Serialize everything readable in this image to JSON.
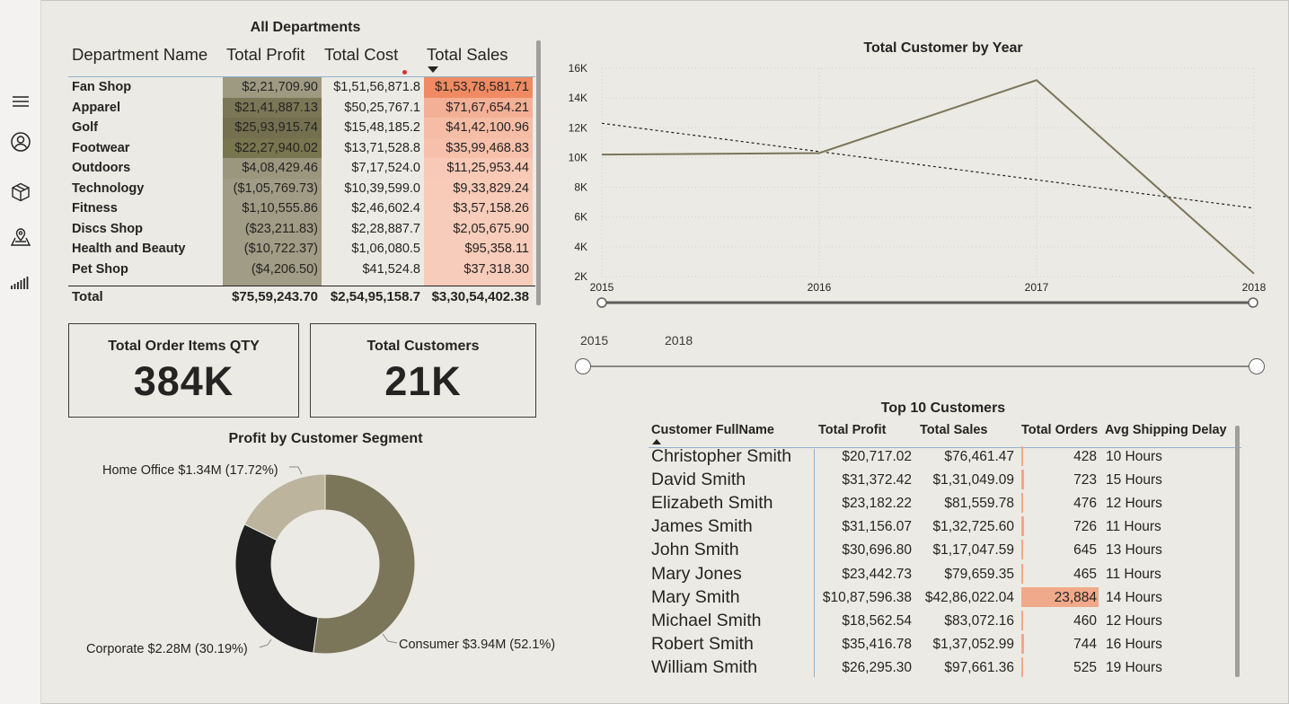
{
  "sidebar": {
    "icons": [
      "menu-icon",
      "user-icon",
      "package-icon",
      "map-icon",
      "bar-signal-icon"
    ]
  },
  "departments": {
    "title": "All Departments",
    "columns": [
      "Department Name",
      "Total Profit",
      "Total Cost",
      "Total Sales"
    ],
    "rows": [
      {
        "name": "Fan Shop",
        "profit": "$2,21,709.90",
        "cost": "$1,51,56,871.8",
        "sales": "$1,53,78,581.71",
        "profit_shade": "#9e9a82",
        "sales_shade": "#ef8a62"
      },
      {
        "name": "Apparel",
        "profit": "$21,41,887.13",
        "cost": "$50,25,767.1",
        "sales": "$71,67,654.21",
        "profit_shade": "#7b7756",
        "sales_shade": "#f4b096"
      },
      {
        "name": "Golf",
        "profit": "$25,93,915.74",
        "cost": "$15,48,185.2",
        "sales": "$41,42,100.96",
        "profit_shade": "#736f4f",
        "sales_shade": "#f6bda6"
      },
      {
        "name": "Footwear",
        "profit": "$22,27,940.02",
        "cost": "$13,71,528.8",
        "sales": "$35,99,468.83",
        "profit_shade": "#79754f",
        "sales_shade": "#f6c0aa"
      },
      {
        "name": "Outdoors",
        "profit": "$4,08,429.46",
        "cost": "$7,17,524.0",
        "sales": "$11,25,953.44",
        "profit_shade": "#9b977e",
        "sales_shade": "#f8c9b6"
      },
      {
        "name": "Technology",
        "profit": "($1,05,769.73)",
        "cost": "$10,39,599.0",
        "sales": "$9,33,829.24",
        "profit_shade": "#a09c85",
        "sales_shade": "#f8cab8"
      },
      {
        "name": "Fitness",
        "profit": "$1,10,555.86",
        "cost": "$2,46,602.4",
        "sales": "$3,57,158.26",
        "profit_shade": "#a09c85",
        "sales_shade": "#f8ccba"
      },
      {
        "name": "Discs Shop",
        "profit": "($23,211.83)",
        "cost": "$2,28,887.7",
        "sales": "$2,05,675.90",
        "profit_shade": "#a09c85",
        "sales_shade": "#f8ccba"
      },
      {
        "name": "Health and Beauty",
        "profit": "($10,722.37)",
        "cost": "$1,06,080.5",
        "sales": "$95,358.11",
        "profit_shade": "#a09c85",
        "sales_shade": "#f8ccba"
      },
      {
        "name": "Pet Shop",
        "profit": "($4,206.50)",
        "cost": "$41,524.8",
        "sales": "$37,318.30",
        "profit_shade": "#a09c85",
        "sales_shade": "#f8ccba"
      }
    ],
    "total": {
      "label": "Total",
      "profit": "$75,59,243.70",
      "cost": "$2,54,95,158.7",
      "sales": "$3,30,54,402.38"
    }
  },
  "cards": {
    "order_items": {
      "label": "Total Order Items QTY",
      "value": "384K"
    },
    "customers": {
      "label": "Total Customers",
      "value": "21K"
    }
  },
  "segment_chart": {
    "title": "Profit by Customer Segment",
    "slices": [
      {
        "name": "Consumer",
        "label": "Consumer $3.94M (52.1%)",
        "value": 3.94,
        "pct": 52.1,
        "color": "#7b7559"
      },
      {
        "name": "Corporate",
        "label": "Corporate $2.28M (30.19%)",
        "value": 2.28,
        "pct": 30.19,
        "color": "#1f1f1f"
      },
      {
        "name": "Home Office",
        "label": "Home Office $1.34M (17.72%)",
        "value": 1.34,
        "pct": 17.72,
        "color": "#bcb49d"
      }
    ]
  },
  "year_chart": {
    "title": "Total Customer by Year",
    "y_ticks": [
      "2K",
      "4K",
      "6K",
      "8K",
      "10K",
      "12K",
      "14K",
      "16K"
    ],
    "x_ticks": [
      "2015",
      "2016",
      "2017",
      "2018"
    ],
    "line_color": "#7b7559"
  },
  "year_slicer": {
    "start_label": "2015",
    "end_label": "2018"
  },
  "top_customers": {
    "title": "Top 10 Customers",
    "columns": [
      "Customer FullName",
      "Total Profit",
      "Total Sales",
      "Total Orders",
      "Avg Shipping Delay"
    ],
    "rows": [
      {
        "name": "Christopher Smith",
        "profit": "$20,717.02",
        "sales": "$76,461.47",
        "orders": "428",
        "orders_n": 428,
        "delay": "10 Hours"
      },
      {
        "name": "David Smith",
        "profit": "$31,372.42",
        "sales": "$1,31,049.09",
        "orders": "723",
        "orders_n": 723,
        "delay": "15 Hours"
      },
      {
        "name": "Elizabeth Smith",
        "profit": "$23,182.22",
        "sales": "$81,559.78",
        "orders": "476",
        "orders_n": 476,
        "delay": "12 Hours"
      },
      {
        "name": "James Smith",
        "profit": "$31,156.07",
        "sales": "$1,32,725.60",
        "orders": "726",
        "orders_n": 726,
        "delay": "11 Hours"
      },
      {
        "name": "John Smith",
        "profit": "$30,696.80",
        "sales": "$1,17,047.59",
        "orders": "645",
        "orders_n": 645,
        "delay": "13 Hours"
      },
      {
        "name": "Mary Jones",
        "profit": "$23,442.73",
        "sales": "$79,659.35",
        "orders": "465",
        "orders_n": 465,
        "delay": "11 Hours"
      },
      {
        "name": "Mary Smith",
        "profit": "$10,87,596.38",
        "sales": "$42,86,022.04",
        "orders": "23,884",
        "orders_n": 23884,
        "delay": "14 Hours"
      },
      {
        "name": "Michael Smith",
        "profit": "$18,562.54",
        "sales": "$83,072.16",
        "orders": "460",
        "orders_n": 460,
        "delay": "12 Hours"
      },
      {
        "name": "Robert Smith",
        "profit": "$35,416.78",
        "sales": "$1,37,052.99",
        "orders": "744",
        "orders_n": 744,
        "delay": "16 Hours"
      },
      {
        "name": "William Smith",
        "profit": "$26,295.30",
        "sales": "$97,661.36",
        "orders": "525",
        "orders_n": 525,
        "delay": "19 Hours"
      }
    ]
  },
  "chart_data": [
    {
      "type": "line",
      "title": "Total Customer by Year",
      "xlabel": "",
      "ylabel": "",
      "x": [
        2015,
        2016,
        2017,
        2018
      ],
      "series": [
        {
          "values": [
            10200,
            10300,
            15200,
            2200
          ]
        },
        {
          "values": [
            12300,
            10400,
            8500,
            6600
          ]
        }
      ],
      "ylim": [
        2000,
        16000
      ],
      "grid": true
    },
    {
      "type": "pie",
      "title": "Profit by Customer Segment",
      "categories": [
        "Consumer",
        "Corporate",
        "Home Office"
      ],
      "values": [
        3.94,
        2.28,
        1.34
      ],
      "percentages": [
        52.1,
        30.19,
        17.72
      ],
      "labels": [
        "Consumer $3.94M (52.1%)",
        "Corporate $2.28M (30.19%)",
        "Home Office $1.34M (17.72%)"
      ]
    }
  ]
}
